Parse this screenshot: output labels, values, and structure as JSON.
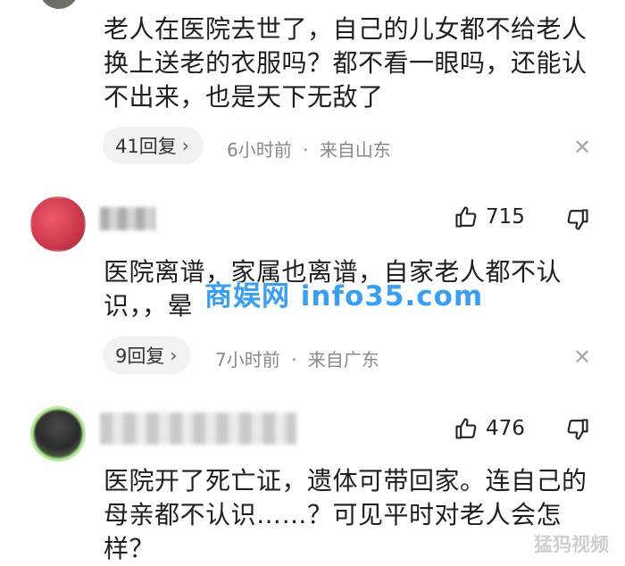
{
  "comments": [
    {
      "text": "老人在医院去世了，自己的儿女都不给老人换上送老的衣服吗？都不看一眼吗，还能认不出来，也是天下无敌了",
      "reply_label": "41回复",
      "time": "6小时前",
      "location": "来自山东"
    },
    {
      "likes": "715",
      "text": "医院离谱，家属也离谱，自家老人都不认识，，晕",
      "reply_label": "9回复",
      "time": "7小时前",
      "location": "来自广东"
    },
    {
      "likes": "476",
      "text": "医院开了死亡证，遗体可带回家。连自己的母亲都不认识……？可见平时对老人会怎样？"
    }
  ],
  "separator": "·",
  "watermark": "商娱网 info35.com",
  "corner_watermark": "猛犸视频",
  "icons": {
    "like": "thumbs-up-icon",
    "dislike": "thumbs-down-icon",
    "close": "close-icon",
    "chevron": "chevron-right-icon"
  },
  "colors": {
    "watermark": "#3a9ef2",
    "pill_bg": "#f2f2f2",
    "meta_text": "#888888"
  }
}
